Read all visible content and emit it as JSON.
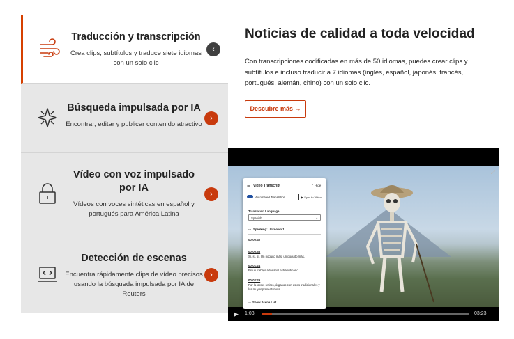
{
  "features": [
    {
      "title": "Traducción y transcripción",
      "desc": "Crea clips, subtítulos y traduce siete idiomas con un solo clic",
      "icon": "wind-lines-icon",
      "arrow": "‹",
      "active": true
    },
    {
      "title": "Búsqueda impulsada por IA",
      "desc": "Encontrar, editar y publicar contenido atractivo",
      "icon": "sparkle-icon",
      "arrow": "›",
      "active": false
    },
    {
      "title": "Vídeo con voz impulsado por IA",
      "desc": "Vídeos con voces sintéticas en español y portugués para América Latina",
      "icon": "lock-icon",
      "arrow": "›",
      "active": false
    },
    {
      "title": "Detección de escenas",
      "desc": "Encuentra rápidamente clips de vídeo precisos usando la búsqueda impulsada por IA de Reuters",
      "icon": "laptop-code-icon",
      "arrow": "›",
      "active": false
    }
  ],
  "panel": {
    "title": "Noticias de calidad a toda velocidad",
    "desc": "Con transcripciones codificadas en más de 50 idiomas, puedes crear clips y subtítulos e incluso traducir a 7 idiomas (inglés, español, japonés, francés, portugués, alemán, chino) con un solo clic.",
    "cta": "Descubre más",
    "cta_arrow": "→"
  },
  "transcript": {
    "title": "Video Transcript",
    "hide": "Hide",
    "auto_label": "Automated Translation",
    "sync": "Sync to Video",
    "lang_label": "Translation Language",
    "lang_value": "Spanish",
    "speaker": "Speaking: Unknown 1",
    "entries": [
      {
        "time": "00:00:40",
        "text": ""
      },
      {
        "time": "00:00:53",
        "text": "Sí, sí, sí. Un poquito más, un poquito más."
      },
      {
        "time": "00:01:24",
        "text": "Es un trabajo artesanal extraordinario."
      },
      {
        "time": "00:02:29",
        "text": "Por la tarde, retiros, órganos con estos tradicionales y las muy representativas."
      }
    ],
    "scene_list": "Show Scene List"
  },
  "video": {
    "current": "1:03",
    "duration": "03:23",
    "progress": 0.05
  },
  "colors": {
    "accent": "#c83a0d",
    "active_border": "#d64000",
    "card_bg": "#e7e7e7"
  }
}
